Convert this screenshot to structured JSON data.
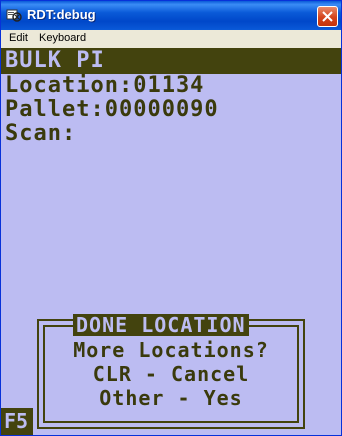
{
  "window": {
    "title": "RDT:debug",
    "icon": "app-icon",
    "close_icon": "close-icon"
  },
  "menu": {
    "items": [
      "Edit",
      "Keyboard"
    ]
  },
  "terminal": {
    "header": "BULK PI",
    "lines": [
      "Location:01134",
      "Pallet:00000090",
      "Scan:"
    ],
    "dialog": {
      "title": "DONE LOCATION",
      "lines": [
        "More Locations?",
        "CLR - Cancel",
        "Other - Yes"
      ]
    },
    "fkey": "F5"
  },
  "colors": {
    "terminal_bg": "#bcbcf2",
    "terminal_fg": "#43430e",
    "titlebar": "#0a5ad8",
    "close": "#d4441c"
  }
}
